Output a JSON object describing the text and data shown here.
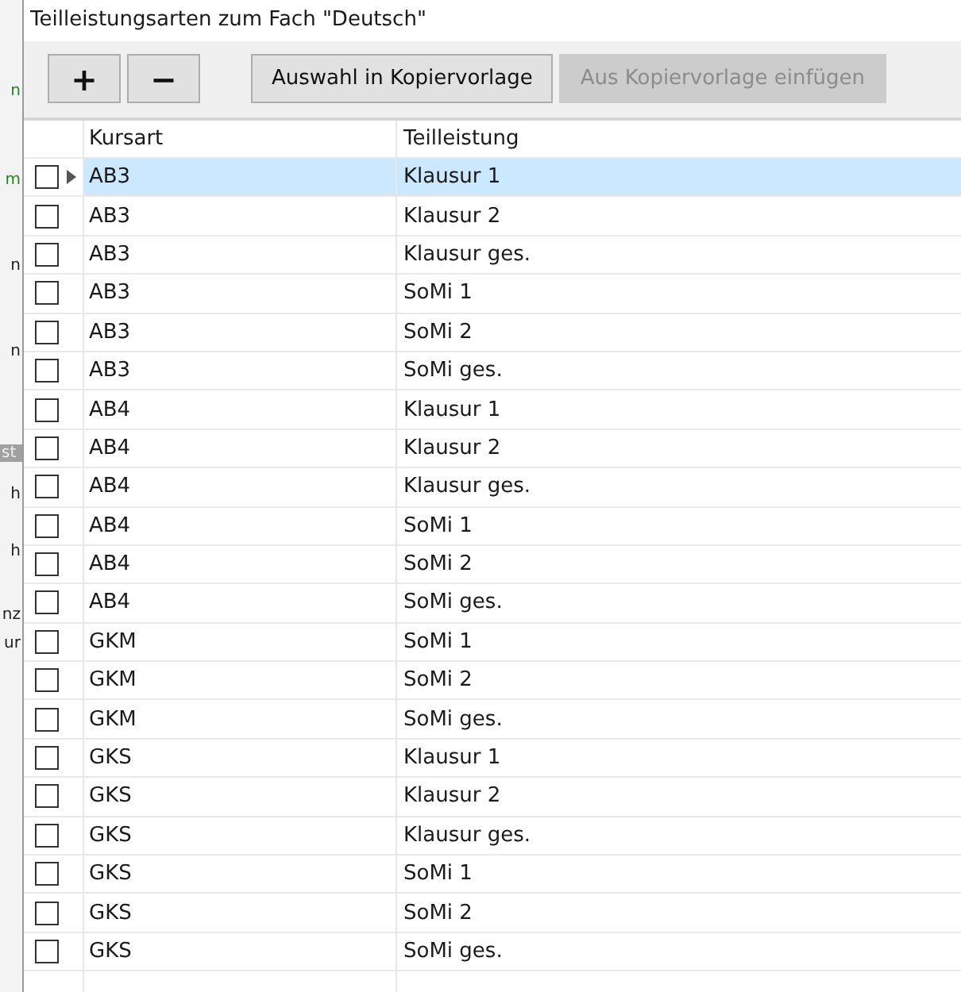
{
  "background_window": {
    "fragments": [
      {
        "text": "n",
        "kind": "green"
      },
      {
        "text": "m",
        "kind": "green"
      },
      {
        "text": "n",
        "kind": "plain"
      },
      {
        "text": "n",
        "kind": "plain"
      },
      {
        "text": "st",
        "kind": "header"
      },
      {
        "text": "h",
        "kind": "plain"
      },
      {
        "text": "h",
        "kind": "plain"
      },
      {
        "text": "nz",
        "kind": "plain"
      },
      {
        "text": "ur",
        "kind": "plain"
      }
    ]
  },
  "dialog": {
    "title": "Teilleistungsarten zum Fach \"Deutsch\""
  },
  "toolbar": {
    "buttons": [
      {
        "label": "+",
        "kind": "icon",
        "disabled": false
      },
      {
        "label": "−",
        "kind": "icon",
        "disabled": false
      },
      {
        "label": "Auswahl in Kopiervorlage",
        "kind": "text",
        "disabled": false
      },
      {
        "label": "Aus Kopiervorlage einfügen",
        "kind": "text",
        "disabled": true
      }
    ]
  },
  "table": {
    "columns": [
      "Kursart",
      "Teilleistung"
    ],
    "rows": [
      {
        "kursart": "AB3",
        "teilleistung": "Klausur 1",
        "checked": false,
        "selected": true
      },
      {
        "kursart": "AB3",
        "teilleistung": "Klausur 2",
        "checked": false,
        "selected": false
      },
      {
        "kursart": "AB3",
        "teilleistung": "Klausur ges.",
        "checked": false,
        "selected": false
      },
      {
        "kursart": "AB3",
        "teilleistung": "SoMi 1",
        "checked": false,
        "selected": false
      },
      {
        "kursart": "AB3",
        "teilleistung": "SoMi 2",
        "checked": false,
        "selected": false
      },
      {
        "kursart": "AB3",
        "teilleistung": "SoMi ges.",
        "checked": false,
        "selected": false
      },
      {
        "kursart": "AB4",
        "teilleistung": "Klausur 1",
        "checked": false,
        "selected": false
      },
      {
        "kursart": "AB4",
        "teilleistung": "Klausur 2",
        "checked": false,
        "selected": false
      },
      {
        "kursart": "AB4",
        "teilleistung": "Klausur ges.",
        "checked": false,
        "selected": false
      },
      {
        "kursart": "AB4",
        "teilleistung": "SoMi 1",
        "checked": false,
        "selected": false
      },
      {
        "kursart": "AB4",
        "teilleistung": "SoMi 2",
        "checked": false,
        "selected": false
      },
      {
        "kursart": "AB4",
        "teilleistung": "SoMi ges.",
        "checked": false,
        "selected": false
      },
      {
        "kursart": "GKM",
        "teilleistung": "SoMi 1",
        "checked": false,
        "selected": false
      },
      {
        "kursart": "GKM",
        "teilleistung": "SoMi 2",
        "checked": false,
        "selected": false
      },
      {
        "kursart": "GKM",
        "teilleistung": "SoMi ges.",
        "checked": false,
        "selected": false
      },
      {
        "kursart": "GKS",
        "teilleistung": "Klausur 1",
        "checked": false,
        "selected": false
      },
      {
        "kursart": "GKS",
        "teilleistung": "Klausur 2",
        "checked": false,
        "selected": false
      },
      {
        "kursart": "GKS",
        "teilleistung": "Klausur ges.",
        "checked": false,
        "selected": false
      },
      {
        "kursart": "GKS",
        "teilleistung": "SoMi 1",
        "checked": false,
        "selected": false
      },
      {
        "kursart": "GKS",
        "teilleistung": "SoMi 2",
        "checked": false,
        "selected": false
      },
      {
        "kursart": "GKS",
        "teilleistung": "SoMi ges.",
        "checked": false,
        "selected": false
      }
    ]
  }
}
